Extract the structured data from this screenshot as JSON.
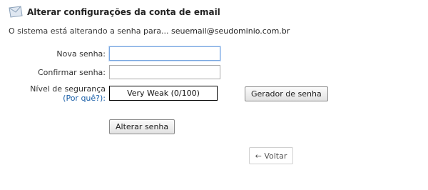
{
  "header": {
    "title": "Alterar configurações da conta de email",
    "icon": "envelope-icon"
  },
  "subline": {
    "text": "O sistema está alterando a senha para...",
    "email": "seuemail@seudominio.com.br"
  },
  "form": {
    "new_password_label": "Nova senha:",
    "new_password_value": "",
    "confirm_password_label": "Confirmar senha:",
    "confirm_password_value": "",
    "strength_label": "Nível de segurança",
    "strength_why": "(Por quê?):",
    "strength_value": "Very Weak (0/100)",
    "generator_button": "Gerador de senha",
    "submit_button": "Alterar senha",
    "back_button": "← Voltar"
  }
}
